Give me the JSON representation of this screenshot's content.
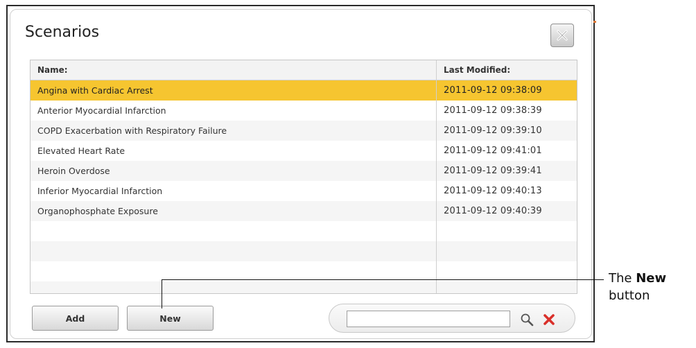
{
  "dialog": {
    "title": "Scenarios"
  },
  "table": {
    "columns": [
      "Name:",
      "Last Modified:"
    ],
    "rows": [
      {
        "name": "Angina with Cardiac Arrest",
        "modified": "2011-09-12 09:38:09",
        "selected": true
      },
      {
        "name": "Anterior Myocardial Infarction",
        "modified": "2011-09-12 09:38:39"
      },
      {
        "name": "COPD Exacerbation with Respiratory Failure",
        "modified": "2011-09-12 09:39:10"
      },
      {
        "name": "Elevated Heart Rate",
        "modified": "2011-09-12 09:41:01"
      },
      {
        "name": "Heroin Overdose",
        "modified": "2011-09-12 09:39:41"
      },
      {
        "name": "Inferior Myocardial Infarction",
        "modified": "2011-09-12 09:40:13"
      },
      {
        "name": "Organophosphate Exposure",
        "modified": "2011-09-12 09:40:39"
      }
    ]
  },
  "buttons": {
    "add_label": "Add",
    "new_label": "New"
  },
  "search": {
    "value": ""
  },
  "callout": {
    "prefix": "The",
    "bold": "New",
    "suffix": "button"
  },
  "colors": {
    "selected_row": "#f6c530",
    "clear_icon": "#d9302a",
    "accent": "#e07b39"
  },
  "icons": {
    "close": "close-icon",
    "search": "search-icon",
    "clear": "clear-icon"
  }
}
